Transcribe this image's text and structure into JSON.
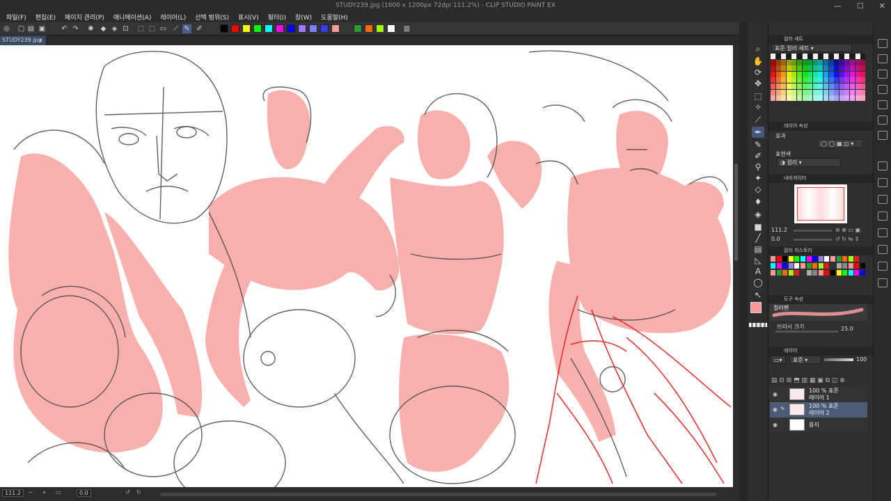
{
  "app": {
    "title": "STUDY239.jpg (1600 x 1200px 72dpi 111.2%) - CLIP STUDIO PAINT EX"
  },
  "window": {
    "minimize": "—",
    "maximize": "☐",
    "close": "✕"
  },
  "menu": [
    "파일(F)",
    "편집(E)",
    "페이지 관리(P)",
    "애니메이션(A)",
    "레이어(L)",
    "선택 범위(S)",
    "표시(V)",
    "필터(I)",
    "창(W)",
    "도움말(H)"
  ],
  "toolbar_colors": [
    "#000000",
    "#ff0000",
    "#ffff00",
    "#00ff00",
    "#00ffff",
    "#ff00ff",
    "#0000ff",
    "#9c7bff",
    "#7f7fff",
    "#3a3aff",
    "#ff9a9a",
    "#2b9b36",
    "#ff6a00",
    "#a3ff00",
    "#ffffff"
  ],
  "document": {
    "tab_label": "STUDY239.jpg",
    "close": "×"
  },
  "status": {
    "zoom": "111.2",
    "angle": "0.0"
  },
  "panels": {
    "color_set": {
      "title": "컬러 세트",
      "set_name": "표준 컬러 세트"
    },
    "layer_property": {
      "title": "레이어 속성",
      "effect_label": "효과",
      "expression_label": "표현색",
      "expression_value": "컬러"
    },
    "navigator": {
      "title": "내비게이터",
      "zoom": "111.2",
      "angle": "0.0"
    },
    "color_history": {
      "title": "컬러 히스토리"
    },
    "tool_property": {
      "title": "도구 속성",
      "tool_name": "컬러펜",
      "brush_size_label": "브러시 크기",
      "brush_size_value": "25.0"
    },
    "layer": {
      "title": "레이어",
      "blend": "표준",
      "opacity": "100",
      "items": [
        {
          "info": "100 % 표준",
          "name": "레이어 1",
          "selected": false
        },
        {
          "info": "100 % 표준",
          "name": "레이어 2",
          "selected": true
        },
        {
          "info": "",
          "name": "용지",
          "selected": false
        }
      ]
    }
  },
  "tools": [
    "zoom-icon",
    "hand-icon",
    "rotate-icon",
    "move-icon",
    "select-icon",
    "wand-icon",
    "eyedropper-icon",
    "pen-icon",
    "pencil-icon",
    "brush-icon",
    "airbrush-icon",
    "decoration-icon",
    "eraser-icon",
    "blend-icon",
    "fill-icon",
    "gradient-icon",
    "figure-icon",
    "frame-icon",
    "ruler-icon",
    "text-icon",
    "balloon-icon",
    "correct-icon"
  ],
  "accent": "#44577a",
  "main_color": "#f79797"
}
